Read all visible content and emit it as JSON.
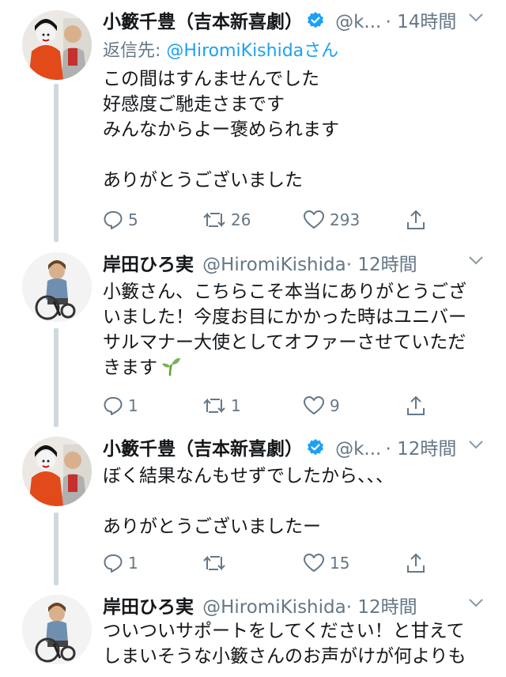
{
  "tweets": [
    {
      "name": "小籔千豊（吉本新喜劇）",
      "verified": true,
      "handle": "@k...",
      "time": "· 14時間",
      "reply_prefix": "返信先:",
      "reply_to": "@HiromiKishidaさん",
      "lines": [
        "この間はすんませんでした",
        "好感度ご馳走さまです",
        "みんなからよー褒められます",
        "",
        "ありがとうございました"
      ],
      "reply_count": "5",
      "retweet_count": "26",
      "like_count": "293"
    },
    {
      "name": "岸田ひろ実",
      "verified": false,
      "handle": "@HiromiKishida",
      "time": "· 12時間",
      "lines": [
        "小籔さん、こちらこそ本当にありがとうござ",
        "いました！今度お目にかかった時はユニバー",
        "サルマナー大使としてオファーさせていただ",
        "きます"
      ],
      "emoji": "seedling-icon",
      "reply_count": "1",
      "retweet_count": "1",
      "like_count": "9"
    },
    {
      "name": "小籔千豊（吉本新喜劇）",
      "verified": true,
      "handle": "@k...",
      "time": "· 12時間",
      "lines": [
        "ぼく結果なんもせずでしたから、、、",
        "",
        "ありがとうございましたー"
      ],
      "reply_count": "1",
      "retweet_count": "",
      "like_count": "15"
    },
    {
      "name": "岸田ひろ実",
      "verified": false,
      "handle": "@HiromiKishida",
      "time": "· 12時間",
      "lines": [
        "ついついサポートをしてください！と甘えて",
        "しまいそうな小籔さんのお声がけが何よりも"
      ]
    }
  ],
  "colors": {
    "text": "#14171a",
    "secondary": "#657786",
    "link": "#1da1f2",
    "thread": "#cfd9de"
  }
}
